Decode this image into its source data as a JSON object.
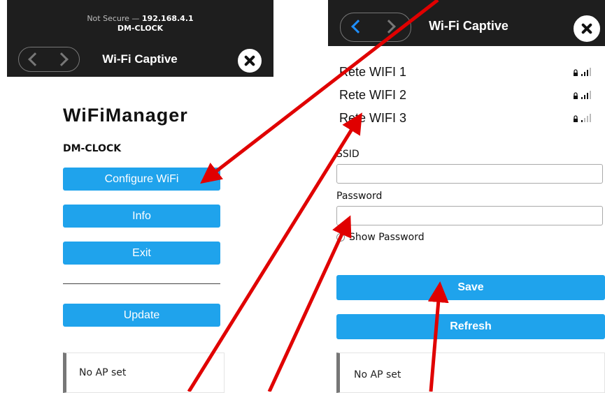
{
  "left": {
    "url_prefix": "Not Secure — ",
    "url_ip": "192.168.4.1",
    "host": "DM-CLOCK",
    "header_title": "Wi-Fi Captive",
    "page_title": "WiFiManager",
    "device_name": "DM-CLOCK",
    "buttons": {
      "configure": "Configure WiFi",
      "info": "Info",
      "exit": "Exit",
      "update": "Update"
    },
    "status_message": "No AP set"
  },
  "right": {
    "header_title": "Wi-Fi Captive",
    "networks": [
      {
        "name": "Rete WIFI 1",
        "signal_icon": "lock-signal-icon"
      },
      {
        "name": "Rete WIFI 2",
        "signal_icon": "lock-signal-icon"
      },
      {
        "name": "Rete WIFI 3",
        "signal_icon": "lock-signal-icon"
      }
    ],
    "ssid_label": "SSID",
    "ssid_value": "",
    "password_label": "Password",
    "password_value": "",
    "show_password_label": "Show Password",
    "save_label": "Save",
    "refresh_label": "Refresh",
    "status_message": "No AP set"
  },
  "colors": {
    "accent": "#1fa3ec",
    "annotation_arrow": "#e00000",
    "header_bg": "#1e1e1e"
  }
}
